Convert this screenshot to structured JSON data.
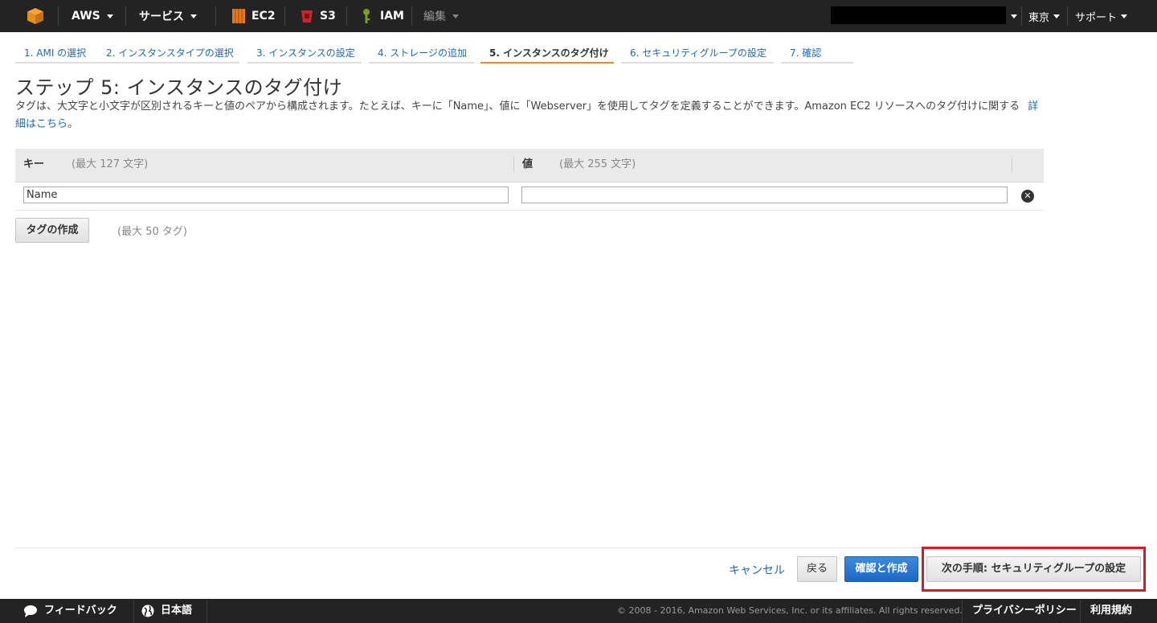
{
  "topnav": {
    "aws_label": "AWS",
    "services_label": "サービス",
    "ec2_label": "EC2",
    "s3_label": "S3",
    "iam_label": "IAM",
    "edit_label": "編集",
    "region_label": "東京",
    "support_label": "サポート"
  },
  "wizard": {
    "steps": [
      {
        "label": "1. AMI の選択"
      },
      {
        "label": "2. インスタンスタイプの選択"
      },
      {
        "label": "3. インスタンスの設定"
      },
      {
        "label": "4. ストレージの追加"
      },
      {
        "label": "5. インスタンスのタグ付け"
      },
      {
        "label": "6. セキュリティグループの設定"
      },
      {
        "label": "7. 確認"
      }
    ],
    "active_index": 4
  },
  "page": {
    "title": "ステップ 5: インスタンスのタグ付け",
    "description": "タグは、大文字と小文字が区別されるキーと値のペアから構成されます。たとえば、キーに「Name」、値に「Webserver」を使用してタグを定義することができます。Amazon EC2 リソースへのタグ付けに関する",
    "learn_more_link": "詳細はこちら",
    "desc_suffix": "。"
  },
  "tags": {
    "key_header": "キー",
    "key_hint": "(最大 127 文字)",
    "value_header": "値",
    "value_hint": "(最大 255 文字)",
    "rows": [
      {
        "key": "Name",
        "value": ""
      }
    ],
    "add_tag_button": "タグの作成",
    "limit_text": "(最大 50 タグ)"
  },
  "actions": {
    "cancel": "キャンセル",
    "back": "戻る",
    "review_launch": "確認と作成",
    "next": "次の手順: セキュリティグループの設定"
  },
  "footer": {
    "feedback": "フィードバック",
    "language": "日本語",
    "copyright": "© 2008 - 2016, Amazon Web Services, Inc. or its affiliates. All rights reserved.",
    "privacy": "プライバシーポリシー",
    "terms": "利用規約"
  },
  "colors": {
    "nav_bg": "#232323",
    "link": "#1c6ab6",
    "active_tab_border": "#f08a24",
    "primary_button": "#1b68c4",
    "highlight": "#e0161e",
    "ec2_icon": "#e8761a",
    "s3_icon": "#c7262b",
    "iam_icon": "#7aa116"
  }
}
